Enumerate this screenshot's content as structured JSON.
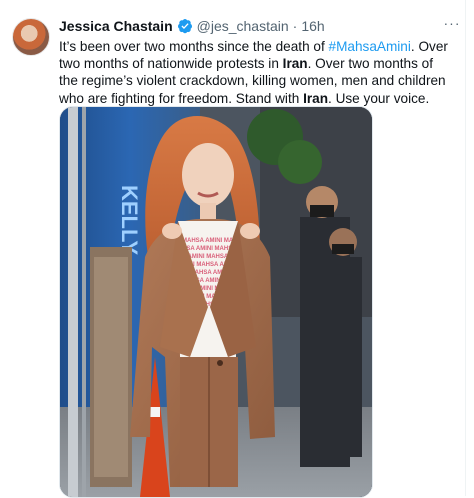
{
  "tweet": {
    "author_name": "Jessica Chastain",
    "handle": "@jes_chastain",
    "separator": "·",
    "time": "16h",
    "text_parts": [
      "It’s been over two months since the death of ",
      "#MahsaAmini",
      ". Over two months of nationwide protests in ",
      "Iran",
      ". Over two months of the regime’s violent crackdown, killing women, men and children who are fighting for freedom. Stand with ",
      "Iran",
      ". Use your voice."
    ],
    "more_label": "···",
    "photo_shirt_text": "MAHSA AMINI MAHSA AMINI MAHSA AMINI MAHSA AMINI MAHSA AMINI MAHSA AMINI MAHSA AMINI MAHSA AMINI MAHSA AMINI MAHSA AMINI MAHSA",
    "photo_sign_text": "KELLY"
  },
  "icons": {
    "verified": "verified-badge-icon",
    "more": "more-options-icon"
  },
  "colors": {
    "link": "#1d9bf0",
    "verified": "#1d9bf0",
    "secondary_text": "#536471"
  }
}
